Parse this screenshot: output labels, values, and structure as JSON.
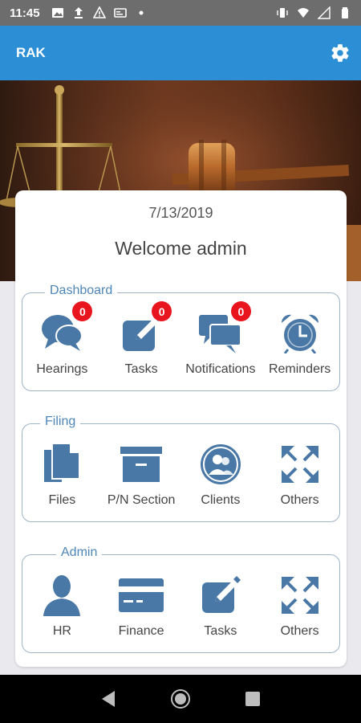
{
  "status_bar": {
    "time": "11:45",
    "left_icons": [
      "image-icon",
      "upload-icon",
      "warning-icon",
      "card-icon",
      "dot-icon"
    ],
    "right_icons": [
      "vibrate-icon",
      "wifi-icon",
      "signal-icon",
      "battery-icon"
    ]
  },
  "app_bar": {
    "title": "RAK",
    "settings_icon": "gear-icon"
  },
  "header": {
    "date": "7/13/2019",
    "welcome": "Welcome admin"
  },
  "sections": {
    "dashboard": {
      "title": "Dashboard",
      "items": [
        {
          "label": "Hearings",
          "icon": "chat-bubbles-icon",
          "badge": "0"
        },
        {
          "label": "Tasks",
          "icon": "edit-icon",
          "badge": "0"
        },
        {
          "label": "Notifications",
          "icon": "messages-icon",
          "badge": "0"
        },
        {
          "label": "Reminders",
          "icon": "alarm-clock-icon"
        }
      ]
    },
    "filing": {
      "title": "Filing",
      "items": [
        {
          "label": "Files",
          "icon": "files-icon"
        },
        {
          "label": "P/N Section",
          "icon": "archive-box-icon"
        },
        {
          "label": "Clients",
          "icon": "users-icon"
        },
        {
          "label": "Others",
          "icon": "expand-arrows-icon"
        }
      ]
    },
    "admin": {
      "title": "Admin",
      "items": [
        {
          "label": "HR",
          "icon": "person-icon"
        },
        {
          "label": "Finance",
          "icon": "credit-card-icon"
        },
        {
          "label": "Tasks",
          "icon": "edit-icon"
        },
        {
          "label": "Others",
          "icon": "expand-arrows-icon"
        }
      ]
    }
  },
  "colors": {
    "app_bar": "#2c8fd6",
    "icon": "#4a78a6",
    "section_title": "#4f86b8",
    "badge": "#e8141e"
  }
}
